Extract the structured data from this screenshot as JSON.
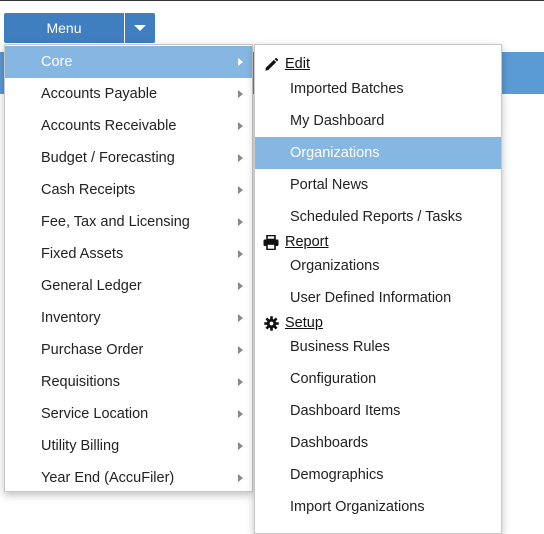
{
  "menu_button": {
    "label": "Menu"
  },
  "menu": {
    "items": [
      {
        "label": "Core",
        "active": true
      },
      {
        "label": "Accounts Payable"
      },
      {
        "label": "Accounts Receivable"
      },
      {
        "label": "Budget / Forecasting"
      },
      {
        "label": "Cash Receipts"
      },
      {
        "label": "Fee, Tax and Licensing"
      },
      {
        "label": "Fixed Assets"
      },
      {
        "label": "General Ledger"
      },
      {
        "label": "Inventory"
      },
      {
        "label": "Purchase Order"
      },
      {
        "label": "Requisitions"
      },
      {
        "label": "Service Location"
      },
      {
        "label": "Utility Billing"
      },
      {
        "label": "Year End (AccuFiler)"
      }
    ]
  },
  "submenu": {
    "edit": {
      "header": "Edit",
      "icon": "pencil-icon",
      "items": [
        "Imported Batches",
        "My Dashboard",
        "Organizations",
        "Portal News",
        "Scheduled Reports / Tasks"
      ],
      "active": "Organizations"
    },
    "report": {
      "header": "Report",
      "icon": "printer-icon",
      "items": [
        "Organizations",
        "User Defined Information"
      ]
    },
    "setup": {
      "header": "Setup",
      "icon": "gear-icon",
      "items": [
        "Business Rules",
        "Configuration",
        "Dashboard Items",
        "Dashboards",
        "Demographics",
        "Import Organizations"
      ]
    }
  },
  "colors": {
    "button_bg": "#3f7fbf",
    "highlight": "#86b7e3",
    "band": "#5b9bd5"
  }
}
